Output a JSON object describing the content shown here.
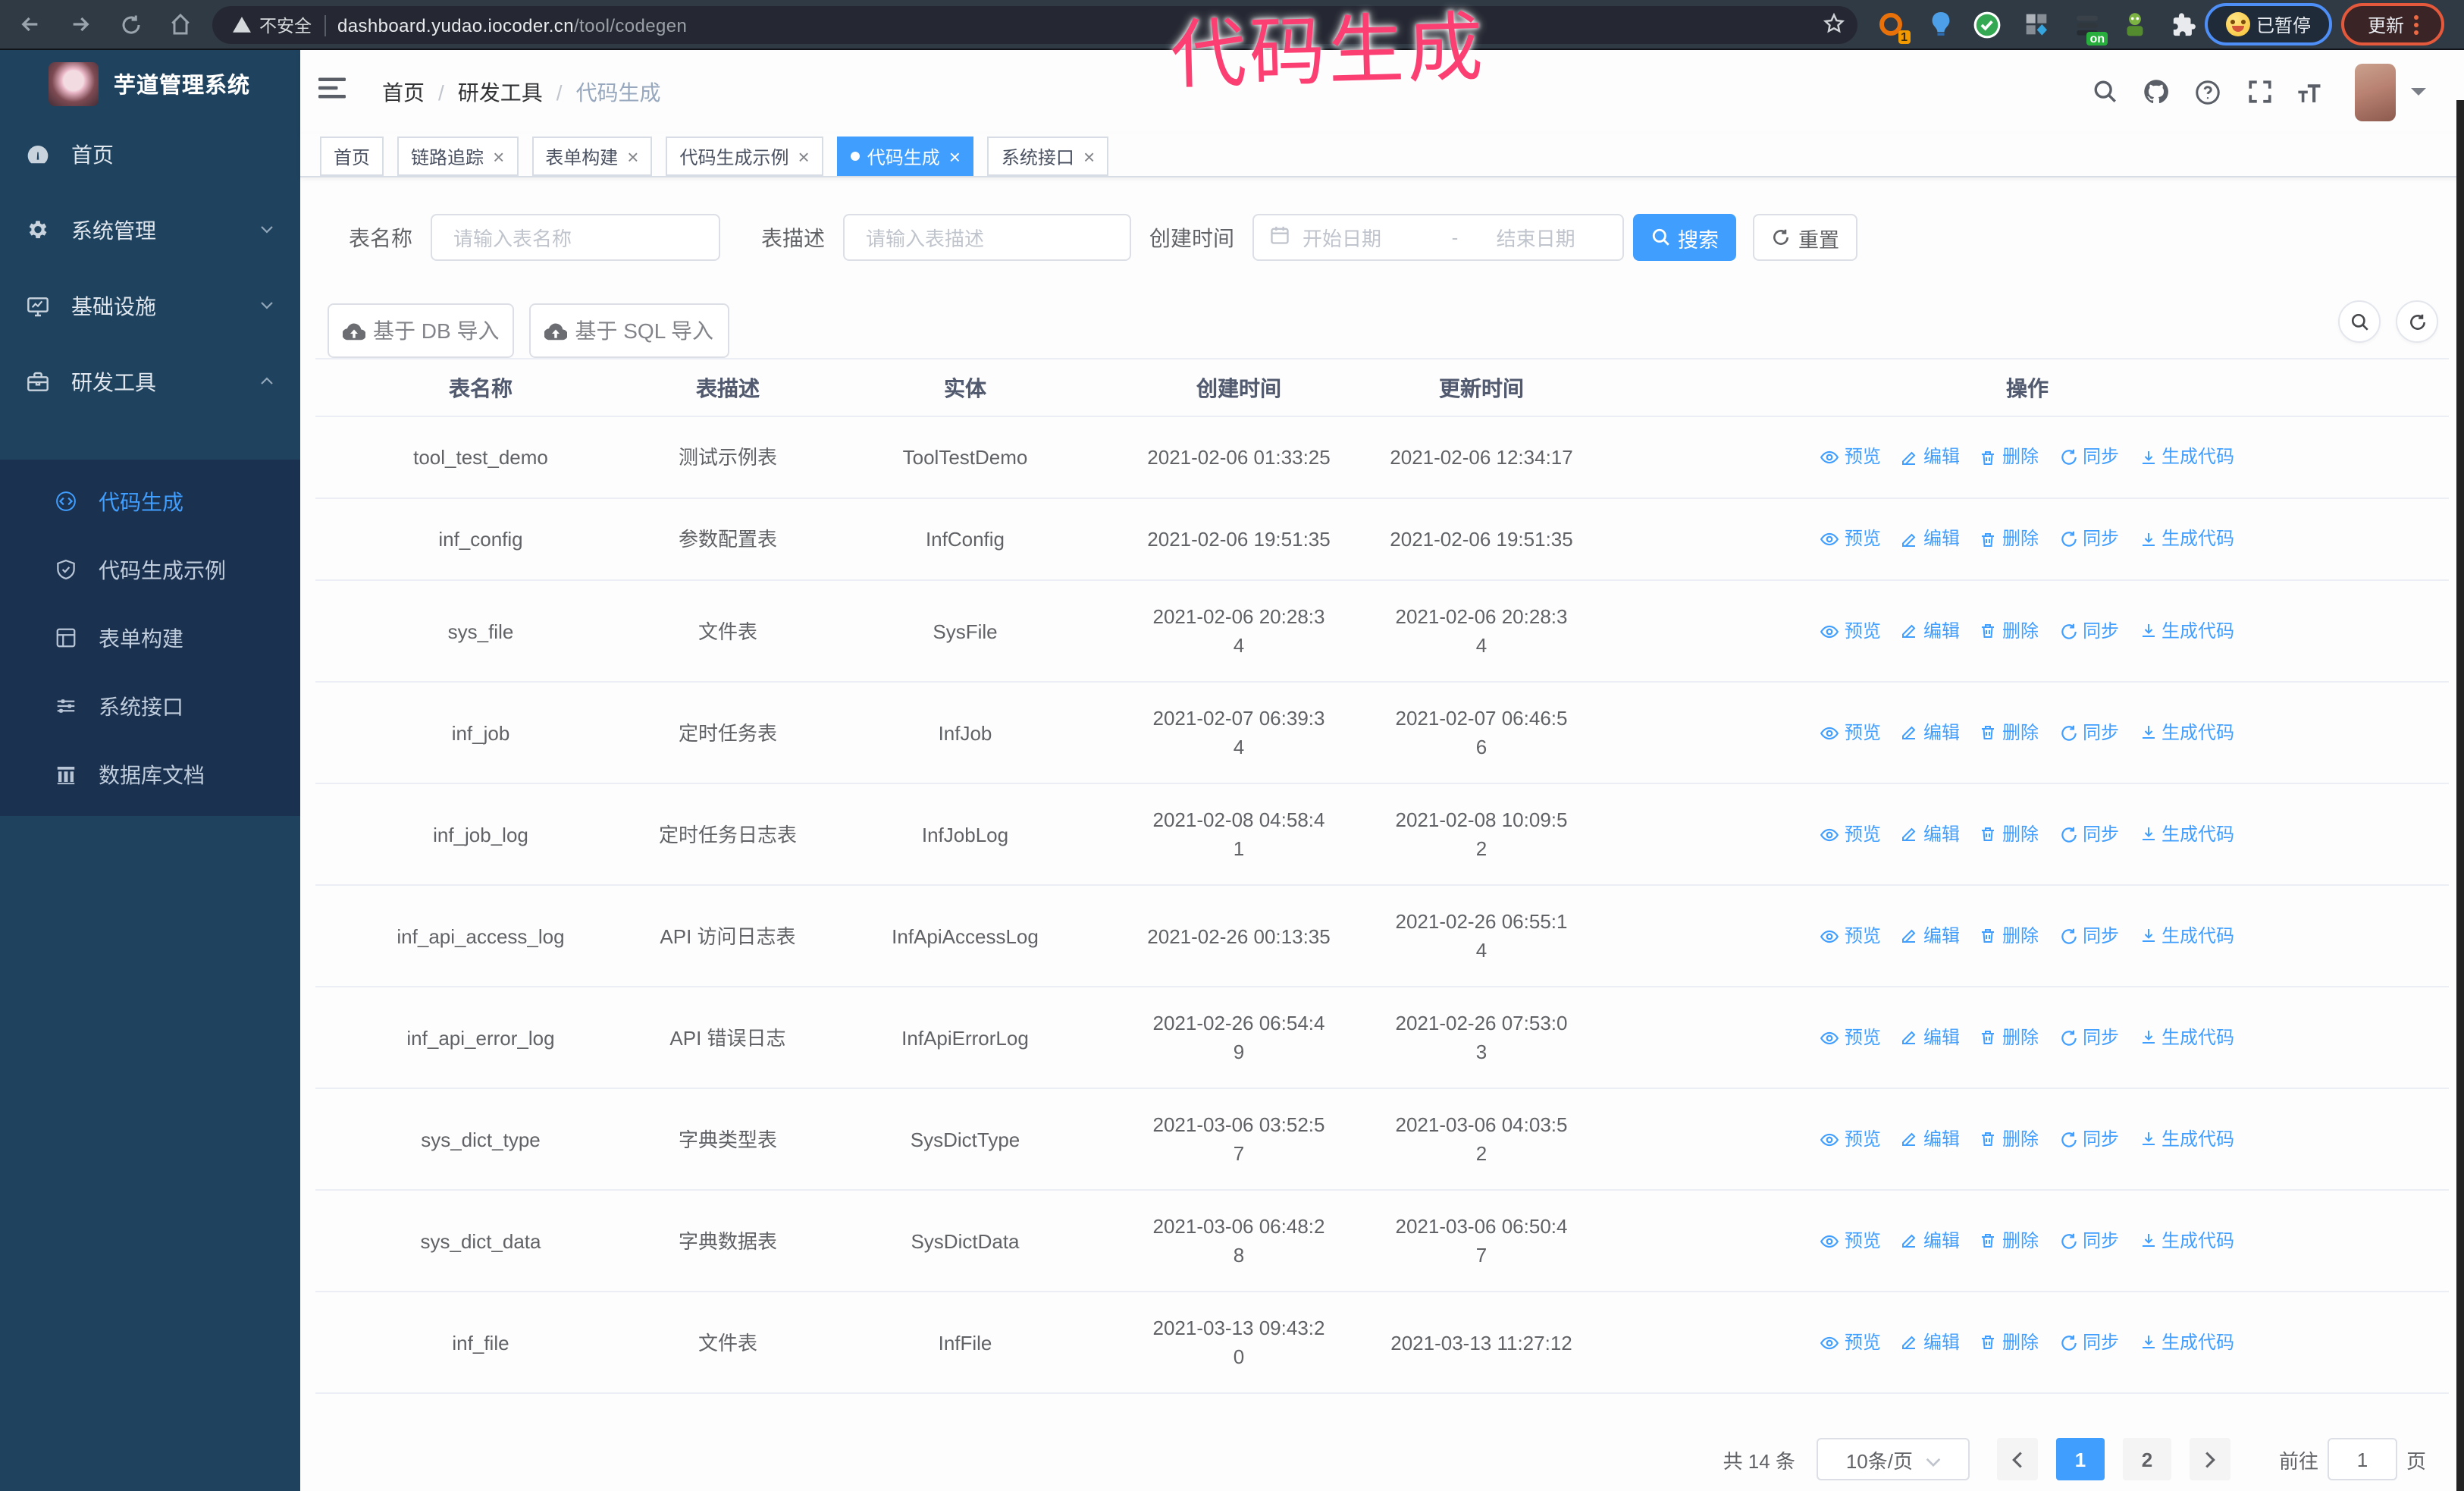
{
  "chrome": {
    "security_label": "不安全",
    "url_host": "dashboard.yudao.iocoder.cn",
    "url_path": "/tool/codegen",
    "paused_label": "已暂停",
    "update_label": "更新",
    "ext_on_badge": "on",
    "ext_count_badge": "1"
  },
  "overlay": {
    "text": "代码生成",
    "color": "#fb3f72"
  },
  "sidebar": {
    "logo_title": "芋道管理系统",
    "items": [
      {
        "label": "首页",
        "icon": "dashboard-icon",
        "chevron": ""
      },
      {
        "label": "系统管理",
        "icon": "gear-icon",
        "chevron": "down"
      },
      {
        "label": "基础设施",
        "icon": "infra-icon",
        "chevron": "down"
      },
      {
        "label": "研发工具",
        "icon": "tools-icon",
        "chevron": "up"
      }
    ],
    "submenu": [
      {
        "label": "代码生成",
        "icon": "code-icon",
        "active": true
      },
      {
        "label": "代码生成示例",
        "icon": "example-icon",
        "active": false
      },
      {
        "label": "表单构建",
        "icon": "form-icon",
        "active": false
      },
      {
        "label": "系统接口",
        "icon": "api-icon",
        "active": false
      },
      {
        "label": "数据库文档",
        "icon": "db-doc-icon",
        "active": false
      }
    ]
  },
  "navbar": {
    "breadcrumb": {
      "items": [
        "首页",
        "研发工具"
      ],
      "separator": "/",
      "current": "代码生成"
    }
  },
  "tabs": [
    {
      "label": "首页",
      "closable": false,
      "active": false
    },
    {
      "label": "链路追踪",
      "closable": true,
      "active": false
    },
    {
      "label": "表单构建",
      "closable": true,
      "active": false
    },
    {
      "label": "代码生成示例",
      "closable": true,
      "active": false
    },
    {
      "label": "代码生成",
      "closable": true,
      "active": true
    },
    {
      "label": "系统接口",
      "closable": true,
      "active": false
    }
  ],
  "search": {
    "name_label": "表名称",
    "name_placeholder": "请输入表名称",
    "desc_label": "表描述",
    "desc_placeholder": "请输入表描述",
    "time_label": "创建时间",
    "start_placeholder": "开始日期",
    "range_separator": "-",
    "end_placeholder": "结束日期",
    "search_label": "搜索",
    "reset_label": "重置"
  },
  "toolbar": {
    "db_import_label": "基于 DB 导入",
    "sql_import_label": "基于 SQL 导入"
  },
  "table": {
    "headers": [
      "表名称",
      "表描述",
      "实体",
      "创建时间",
      "更新时间",
      "操作"
    ],
    "op_labels": [
      {
        "label": "预览",
        "icon": "eye-icon"
      },
      {
        "label": "编辑",
        "icon": "edit-icon"
      },
      {
        "label": "删除",
        "icon": "delete-icon"
      },
      {
        "label": "同步",
        "icon": "sync-icon"
      },
      {
        "label": "生成代码",
        "icon": "download-icon"
      }
    ],
    "rows": [
      {
        "name": "tool_test_demo",
        "desc": "测试示例表",
        "entity": "ToolTestDemo",
        "created": "2021-02-06 01:33:25",
        "updated": "2021-02-06 12:34:17"
      },
      {
        "name": "inf_config",
        "desc": "参数配置表",
        "entity": "InfConfig",
        "created": "2021-02-06 19:51:35",
        "updated": "2021-02-06 19:51:35"
      },
      {
        "name": "sys_file",
        "desc": "文件表",
        "entity": "SysFile",
        "created": "2021-02-06 20:28:3\n4",
        "updated": "2021-02-06 20:28:3\n4"
      },
      {
        "name": "inf_job",
        "desc": "定时任务表",
        "entity": "InfJob",
        "created": "2021-02-07 06:39:3\n4",
        "updated": "2021-02-07 06:46:5\n6"
      },
      {
        "name": "inf_job_log",
        "desc": "定时任务日志表",
        "entity": "InfJobLog",
        "created": "2021-02-08 04:58:4\n1",
        "updated": "2021-02-08 10:09:5\n2"
      },
      {
        "name": "inf_api_access_log",
        "desc": "API 访问日志表",
        "entity": "InfApiAccessLog",
        "created": "2021-02-26 00:13:35",
        "updated": "2021-02-26 06:55:1\n4"
      },
      {
        "name": "inf_api_error_log",
        "desc": "API 错误日志",
        "entity": "InfApiErrorLog",
        "created": "2021-02-26 06:54:4\n9",
        "updated": "2021-02-26 07:53:0\n3"
      },
      {
        "name": "sys_dict_type",
        "desc": "字典类型表",
        "entity": "SysDictType",
        "created": "2021-03-06 03:52:5\n7",
        "updated": "2021-03-06 04:03:5\n2"
      },
      {
        "name": "sys_dict_data",
        "desc": "字典数据表",
        "entity": "SysDictData",
        "created": "2021-03-06 06:48:2\n8",
        "updated": "2021-03-06 06:50:4\n7"
      },
      {
        "name": "inf_file",
        "desc": "文件表",
        "entity": "InfFile",
        "created": "2021-03-13 09:43:2\n0",
        "updated": "2021-03-13 11:27:12"
      }
    ]
  },
  "pagination": {
    "total_label": "共 14 条",
    "page_size_label": "10条/页",
    "pages": [
      "1",
      "2"
    ],
    "active_page": "1",
    "goto_label": "前往",
    "goto_value": "1",
    "unit_label": "页"
  }
}
